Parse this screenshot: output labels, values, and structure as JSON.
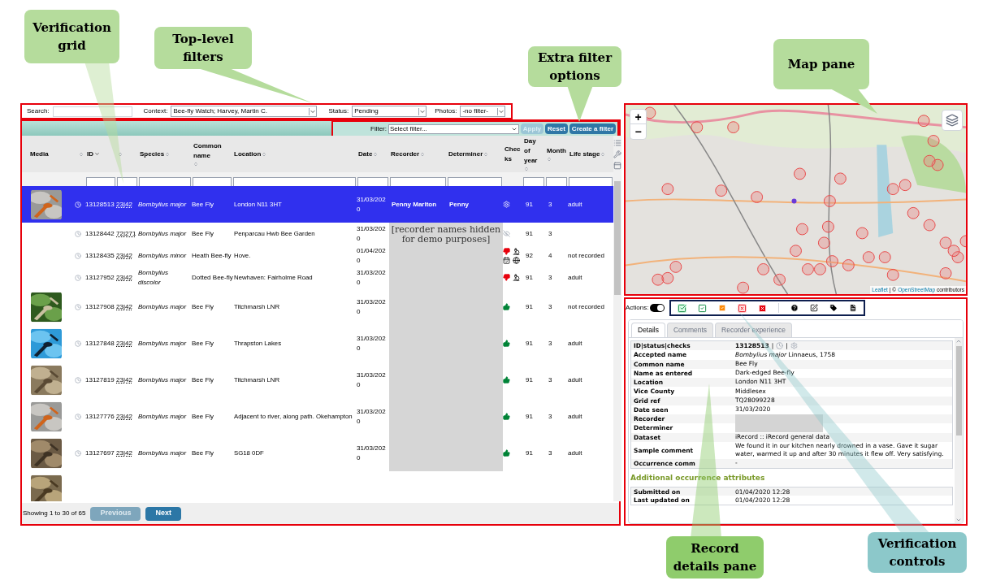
{
  "callouts": [
    {
      "text": "Verification grid",
      "color": "#b5dc9c"
    },
    {
      "text": "Top-level filters",
      "color": "#b5dc9c"
    },
    {
      "text": "Extra filter options",
      "color": "#b5dc9c"
    },
    {
      "text": "Map pane",
      "color": "#b5dc9c"
    },
    {
      "text": "Record details pane",
      "color": "#8fcc6c"
    },
    {
      "text": "Verification controls",
      "color": "#8cc8ca"
    }
  ],
  "filters": {
    "search_label": "Search:",
    "context_label": "Context:",
    "context_value": "Bee-fly Watch; Harvey, Martin C.",
    "status_label": "Status:",
    "status_value": "Pending",
    "photos_label": "Photos:",
    "photos_value": "-no filter-"
  },
  "filter_bar": {
    "label": "Filter:",
    "value": "Select filter...",
    "buttons": [
      {
        "label": "Apply",
        "disabled": true
      },
      {
        "label": "Reset",
        "disabled": false
      },
      {
        "label": "Create a filter",
        "disabled": false
      }
    ]
  },
  "grid": {
    "columns": [
      {
        "label": "Media",
        "sortable": true,
        "sorted": false,
        "filter": false
      },
      {
        "label": "ID",
        "sortable": true,
        "sorted": true,
        "filter": true
      },
      {
        "sortable": true,
        "sorted": false,
        "filter": true
      },
      {
        "label": "Species",
        "sortable": true,
        "sorted": false,
        "filter": true
      },
      {
        "label": "Common name",
        "sortable": true,
        "sorted": false,
        "filter": true
      },
      {
        "label": "Location",
        "sortable": true,
        "sorted": false,
        "filter": true
      },
      {
        "label": "Date",
        "sortable": true,
        "sorted": false,
        "filter": true
      },
      {
        "label": "Recorder",
        "sortable": true,
        "sorted": false,
        "filter": true
      },
      {
        "label": "Determiner",
        "sortable": true,
        "sorted": false,
        "filter": true
      },
      {
        "label": "Checks",
        "sortable": false,
        "filter": false
      },
      {
        "label": "Day of year",
        "sortable": true,
        "sorted": false,
        "filter": true
      },
      {
        "label": "Month",
        "sortable": true,
        "sorted": false,
        "filter": true
      },
      {
        "label": "Life stage",
        "sortable": true,
        "sorted": false,
        "filter": true
      }
    ],
    "rows": [
      {
        "selected": true,
        "photo": true,
        "id": "13128513",
        "grid": "23|42",
        "species": "Bombylius major",
        "common": "Bee Fly",
        "location": "London N11 3HT",
        "date": "31/03/2020",
        "recorder": "Penny Marlton",
        "determiner": "Penny",
        "checks": [
          {
            "kind": "gear"
          }
        ],
        "day": "91",
        "month": "3",
        "recorder_hidden": false,
        "stage": "adult"
      },
      {
        "selected": false,
        "photo": false,
        "id": "13128442",
        "grid": "72|271",
        "species": "Bombylius major",
        "common": "Bee Fly",
        "location": "Penparcau Hwb Bee Garden",
        "date": "31/03/2020",
        "recorder_hidden": true,
        "checks": [
          {
            "kind": "eye-off"
          }
        ],
        "day": "91",
        "month": "3"
      },
      {
        "selected": false,
        "photo": false,
        "id": "13128435",
        "grid": "23|42",
        "species": "Bombylius minor",
        "common": "Heath Bee-fly",
        "location": "Hove.",
        "date": "01/04/2020",
        "recorder_hidden": true,
        "checks": [
          {
            "kind": "thumbs-down"
          },
          {
            "kind": "microscope"
          },
          {
            "kind": "calendar"
          },
          {
            "kind": "globe"
          }
        ],
        "day": "92",
        "month": "4",
        "stage": "not recorded"
      },
      {
        "selected": false,
        "photo": false,
        "id": "13127952",
        "grid": "23|42",
        "species": "Bombylius discolor",
        "common": "Dotted Bee-fly",
        "location": "Newhaven: Fairholme Road",
        "date": "31/03/2020",
        "recorder_hidden": true,
        "checks": [
          {
            "kind": "thumbs-down"
          },
          {
            "kind": "microscope"
          }
        ],
        "day": "91",
        "month": "3",
        "stage": "adult"
      },
      {
        "selected": false,
        "photo": true,
        "id": "13127908",
        "grid": "23|42",
        "species": "Bombylius major",
        "common": "Bee Fly",
        "location": "Titchmarsh LNR",
        "date": "31/03/2020",
        "recorder_hidden": true,
        "checks": [
          {
            "kind": "thumbs-up"
          }
        ],
        "day": "91",
        "month": "3",
        "stage": "not recorded"
      },
      {
        "selected": false,
        "photo": true,
        "id": "13127848",
        "grid": "23|42",
        "species": "Bombylius major",
        "common": "Bee Fly",
        "location": "Thrapston Lakes",
        "date": "31/03/2020",
        "recorder_hidden": true,
        "checks": [
          {
            "kind": "thumbs-up"
          }
        ],
        "day": "91",
        "month": "3",
        "stage": "adult"
      },
      {
        "selected": false,
        "photo": true,
        "id": "13127819",
        "grid": "23|42",
        "species": "Bombylius major",
        "common": "Bee Fly",
        "location": "Titchmarsh LNR",
        "date": "31/03/2020",
        "recorder_hidden": true,
        "checks": [
          {
            "kind": "thumbs-up"
          }
        ],
        "day": "91",
        "month": "3",
        "stage": "adult"
      },
      {
        "selected": false,
        "photo": true,
        "id": "13127776",
        "grid": "23|42",
        "species": "Bombylius major",
        "common": "Bee Fly",
        "location": "Adjacent to river, along path. Okehampton",
        "date": "31/03/2020",
        "recorder_hidden": true,
        "checks": [
          {
            "kind": "thumbs-up"
          }
        ],
        "day": "91",
        "month": "3",
        "stage": "adult"
      },
      {
        "selected": false,
        "photo": true,
        "id": "13127697",
        "grid": "23|42",
        "species": "Bombylius major",
        "common": "Bee Fly",
        "location": "SG18 0DF",
        "date": "31/03/2020",
        "recorder_hidden": true,
        "checks": [
          {
            "kind": "thumbs-up"
          }
        ],
        "day": "91",
        "month": "3",
        "stage": "adult"
      },
      {
        "selected": false,
        "photo": true,
        "recorder_hidden": false,
        "checks": []
      }
    ],
    "hidden_note": "[recorder names hidden for demo purposes]",
    "footer": "Showing 1 to 30 of 65",
    "pager": [
      {
        "label": "Previous",
        "disabled": true
      },
      {
        "label": "Next",
        "disabled": false
      }
    ]
  },
  "map": {
    "zoom_in": "+",
    "zoom_out": "−",
    "attribution": {
      "link1": "Leaflet",
      "separator": "| ©",
      "link2": "OpenStreetMap",
      "suffix": "contributors"
    }
  },
  "details": {
    "actions_label": "Actions:",
    "actions_toggle_on": true,
    "tabs": [
      {
        "label": "Details",
        "selected": true
      },
      {
        "label": "Comments",
        "selected": false
      },
      {
        "label": "Recorder experience",
        "selected": false
      }
    ],
    "rows": [
      {
        "kind": "id",
        "label": "ID|status|checks",
        "value": "13128513",
        "separators": [
          "|",
          "|"
        ]
      },
      {
        "kind": "text",
        "label": "Accepted name",
        "value": "*Bombylius major* Linnaeus, 1758"
      },
      {
        "kind": "text",
        "label": "Common name",
        "value": "Bee Fly"
      },
      {
        "kind": "text",
        "label": "Name as entered",
        "value": "Dark-edged Bee-fly"
      },
      {
        "kind": "text",
        "label": "Location",
        "value": "London N11 3HT"
      },
      {
        "kind": "text",
        "label": "Vice County",
        "value": "Middlesex"
      },
      {
        "kind": "text",
        "label": "Grid ref",
        "value": "TQ28099228"
      },
      {
        "kind": "text",
        "label": "Date seen",
        "value": "31/03/2020"
      },
      {
        "kind": "hidden",
        "label": "Recorder"
      },
      {
        "kind": "hidden",
        "label": "Determiner"
      },
      {
        "kind": "text",
        "label": "Dataset",
        "value": "iRecord :: iRecord general data"
      },
      {
        "kind": "text",
        "label": "Sample comment",
        "value": "We found it in our kitchen nearly drowned in a vase. Gave it sugar water, warmed it up and after 30 minutes it flew off. Very satisfying."
      },
      {
        "kind": "text",
        "label": "Occurrence comm",
        "value": "-"
      }
    ],
    "section_title": "Additional occurrence attributes",
    "attributes": [
      {
        "label": "Submitted on",
        "value": "01/04/2020 12:28"
      },
      {
        "label": "Last updated on",
        "value": "01/04/2020 12:28"
      }
    ]
  }
}
